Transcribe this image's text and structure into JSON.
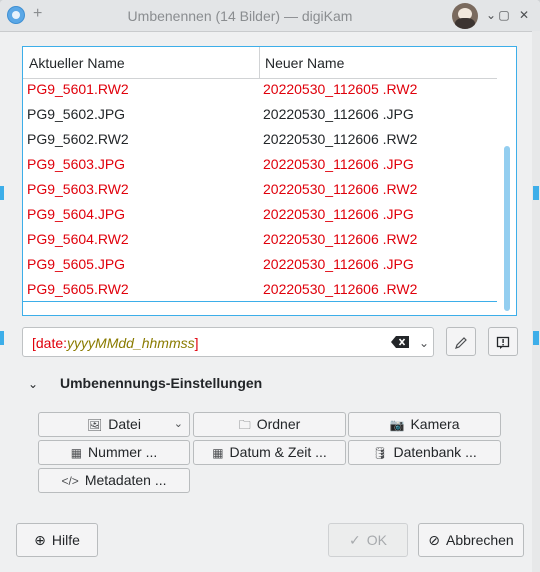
{
  "titlebar": {
    "title": "Umbenennen (14 Bilder) — digiKam",
    "add_glyph": "+",
    "min_glyph": "⌄",
    "max_glyph": "▢",
    "close_glyph": "✕"
  },
  "table": {
    "col1_header": "Aktueller Name",
    "col2_header": "Neuer Name",
    "rows": [
      {
        "current": "PG9_5601.RW2",
        "new": "20220530_112605 .RW2",
        "color": "red"
      },
      {
        "current": "PG9_5602.JPG",
        "new": "20220530_112606 .JPG",
        "color": "black"
      },
      {
        "current": "PG9_5602.RW2",
        "new": "20220530_112606 .RW2",
        "color": "black"
      },
      {
        "current": "PG9_5603.JPG",
        "new": "20220530_112606 .JPG",
        "color": "red"
      },
      {
        "current": "PG9_5603.RW2",
        "new": "20220530_112606 .RW2",
        "color": "red"
      },
      {
        "current": "PG9_5604.JPG",
        "new": "20220530_112606 .JPG",
        "color": "red"
      },
      {
        "current": "PG9_5604.RW2",
        "new": "20220530_112606 .RW2",
        "color": "red"
      },
      {
        "current": "PG9_5605.JPG",
        "new": "20220530_112606 .JPG",
        "color": "red"
      },
      {
        "current": "PG9_5605.RW2",
        "new": "20220530_112606 .RW2",
        "color": "red"
      }
    ]
  },
  "pattern": {
    "prefix": "[date:",
    "format": "yyyyMMdd_hhmmss",
    "suffix": "]",
    "clear_icon": "backspace-clear-icon",
    "dropdown_glyph": "⌄"
  },
  "section": {
    "chevron": "⌄",
    "label": "Umbenennungs-Einstellungen"
  },
  "options": {
    "datei": {
      "label": "Datei",
      "icon": "🖼",
      "dropdown": "⌄"
    },
    "ordner": {
      "label": "Ordner",
      "icon": "🗀"
    },
    "kamera": {
      "label": "Kamera",
      "icon": "📷"
    },
    "nummer": {
      "label": "Nummer ...",
      "icon": "▦"
    },
    "datum": {
      "label": "Datum & Zeit ...",
      "icon": "▦"
    },
    "datenbank": {
      "label": "Datenbank ...",
      "icon": "🛢"
    },
    "metadaten": {
      "label": "Metadaten ...",
      "icon": "</>"
    }
  },
  "footer": {
    "help": "Hilfe",
    "help_icon": "⊕",
    "ok": "OK",
    "ok_icon": "✓",
    "cancel": "Abbrechen",
    "cancel_icon": "⊘"
  },
  "colors": {
    "accent": "#3daee9",
    "red_text": "#e0000b",
    "olive_text": "#8a7b00"
  }
}
